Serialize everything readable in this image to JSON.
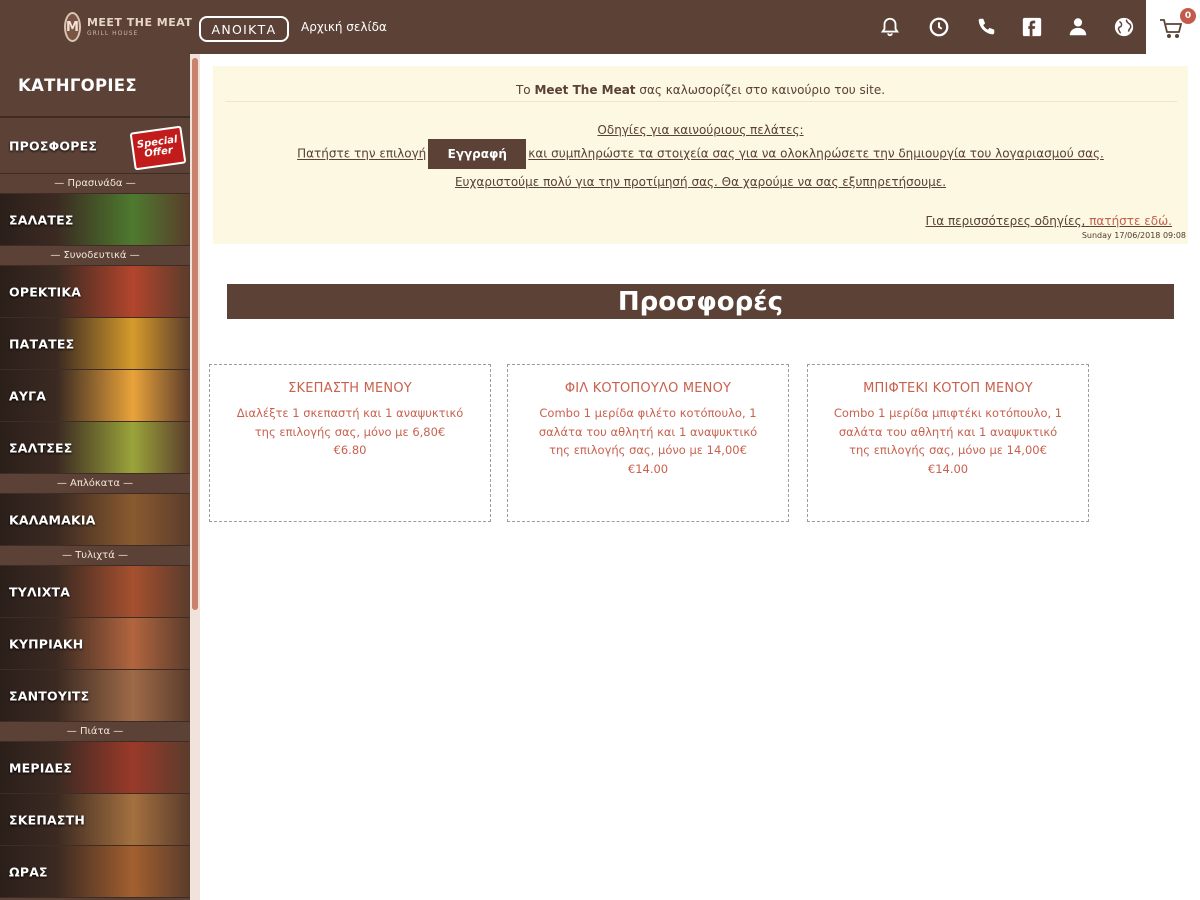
{
  "header": {
    "logo": {
      "line1": "MEET THE MEAT",
      "line2": "GRILL HOUSE"
    },
    "open_status": "ΑΝΟΙΚΤΑ",
    "home_link": "Αρχική σελίδα",
    "icons": [
      "bell-icon",
      "clock-icon",
      "phone-icon",
      "facebook-icon",
      "user-icon",
      "globe-icon",
      "cart-icon"
    ],
    "cart_count": "0"
  },
  "sidebar": {
    "title": "ΚΑΤΗΓΟΡΙΕΣ",
    "promo": {
      "label": "ΠΡΟΣΦΟΡΕΣ",
      "badge_line1": "Special",
      "badge_line2": "Offer"
    },
    "sections": [
      {
        "heading": "— Πρασινάδα —",
        "items": [
          {
            "label": "ΣΑΛΑΤΕΣ",
            "accent": "#4e7a2e"
          }
        ]
      },
      {
        "heading": "— Συνοδευτικά —",
        "items": [
          {
            "label": "ΟΡΕΚΤΙΚΑ",
            "accent": "#b3452d"
          },
          {
            "label": "ΠΑΤΑΤΕΣ",
            "accent": "#d69b2b"
          },
          {
            "label": "ΑΥΓΑ",
            "accent": "#e9a33a"
          },
          {
            "label": "ΣΑΛΤΣΕΣ",
            "accent": "#9aa43a"
          }
        ]
      },
      {
        "heading": "— Απλόκατα —",
        "items": [
          {
            "label": "ΚΑΛΑΜΑΚΙΑ",
            "accent": "#8a5a2f"
          }
        ]
      },
      {
        "heading": "— Τυλιχτά —",
        "items": [
          {
            "label": "ΤΥΛΙΧΤΑ",
            "accent": "#a6502f"
          },
          {
            "label": "ΚΥΠΡΙΑΚΗ",
            "accent": "#b2653f"
          },
          {
            "label": "ΣΑΝΤΟΥΙΤΣ",
            "accent": "#9e6a48"
          }
        ]
      },
      {
        "heading": "— Πιάτα —",
        "items": [
          {
            "label": "ΜΕΡΙΔΕΣ",
            "accent": "#9a3a2a"
          },
          {
            "label": "ΣΚΕΠΑΣΤΗ",
            "accent": "#a4703f"
          },
          {
            "label": "ΩΡΑΣ",
            "accent": "#a3602f"
          }
        ]
      }
    ]
  },
  "notice": {
    "welcome_pre": "Το ",
    "welcome_brand": "Meet The Meat",
    "welcome_post": " σας καλωσορίζει στο καινούριο του site.",
    "guide_title": "Οδηγίες για καινούριους πελάτες:",
    "step_pre": "Πατήστε την επιλογή",
    "register_button": "Εγγραφή",
    "step_post": "και συμπληρώστε τα στοιχεία σας για να ολοκληρώσετε την δημιουργία του λογαριασμού σας.",
    "thanks": "Ευχαριστούμε πολύ για την προτίμησή σας. Θα χαρούμε να σας εξυπηρετήσουμε.",
    "more_text": "Για περισσότερες οδηγίες,",
    "more_link": "πατήστε εδώ.",
    "date": "Sunday 17/06/2018 09:08"
  },
  "offers": {
    "title": "Προσφορές",
    "items": [
      {
        "title": "ΣΚΕΠΑΣΤΗ ΜΕΝΟΥ",
        "description": "Διαλέξτε 1 σκεπαστή και 1 αναψυκτικό της επιλογής σας, μόνο με 6,80€",
        "price": "€6.80"
      },
      {
        "title": "ΦΙΛ ΚΟΤΟΠΟΥΛΟ ΜΕΝΟΥ",
        "description": "Combo 1 μερίδα φιλέτο κοτόπουλο, 1 σαλάτα του αθλητή και 1 αναψυκτικό της επιλογής σας, μόνο με 14,00€",
        "price": "€14.00"
      },
      {
        "title": "ΜΠΙΦΤΕΚΙ ΚΟΤΟΠ ΜΕΝΟΥ",
        "description": "Combo 1 μερίδα μπιφτέκι κοτόπουλο, 1 σαλάτα του αθλητή και 1 αναψυκτικό της επιλογής σας, μόνο με 14,00€",
        "price": "€14.00"
      }
    ]
  },
  "colors": {
    "brand_brown": "#5b4136",
    "accent_red": "#c8614e",
    "notice_bg": "#fdf8e2"
  }
}
